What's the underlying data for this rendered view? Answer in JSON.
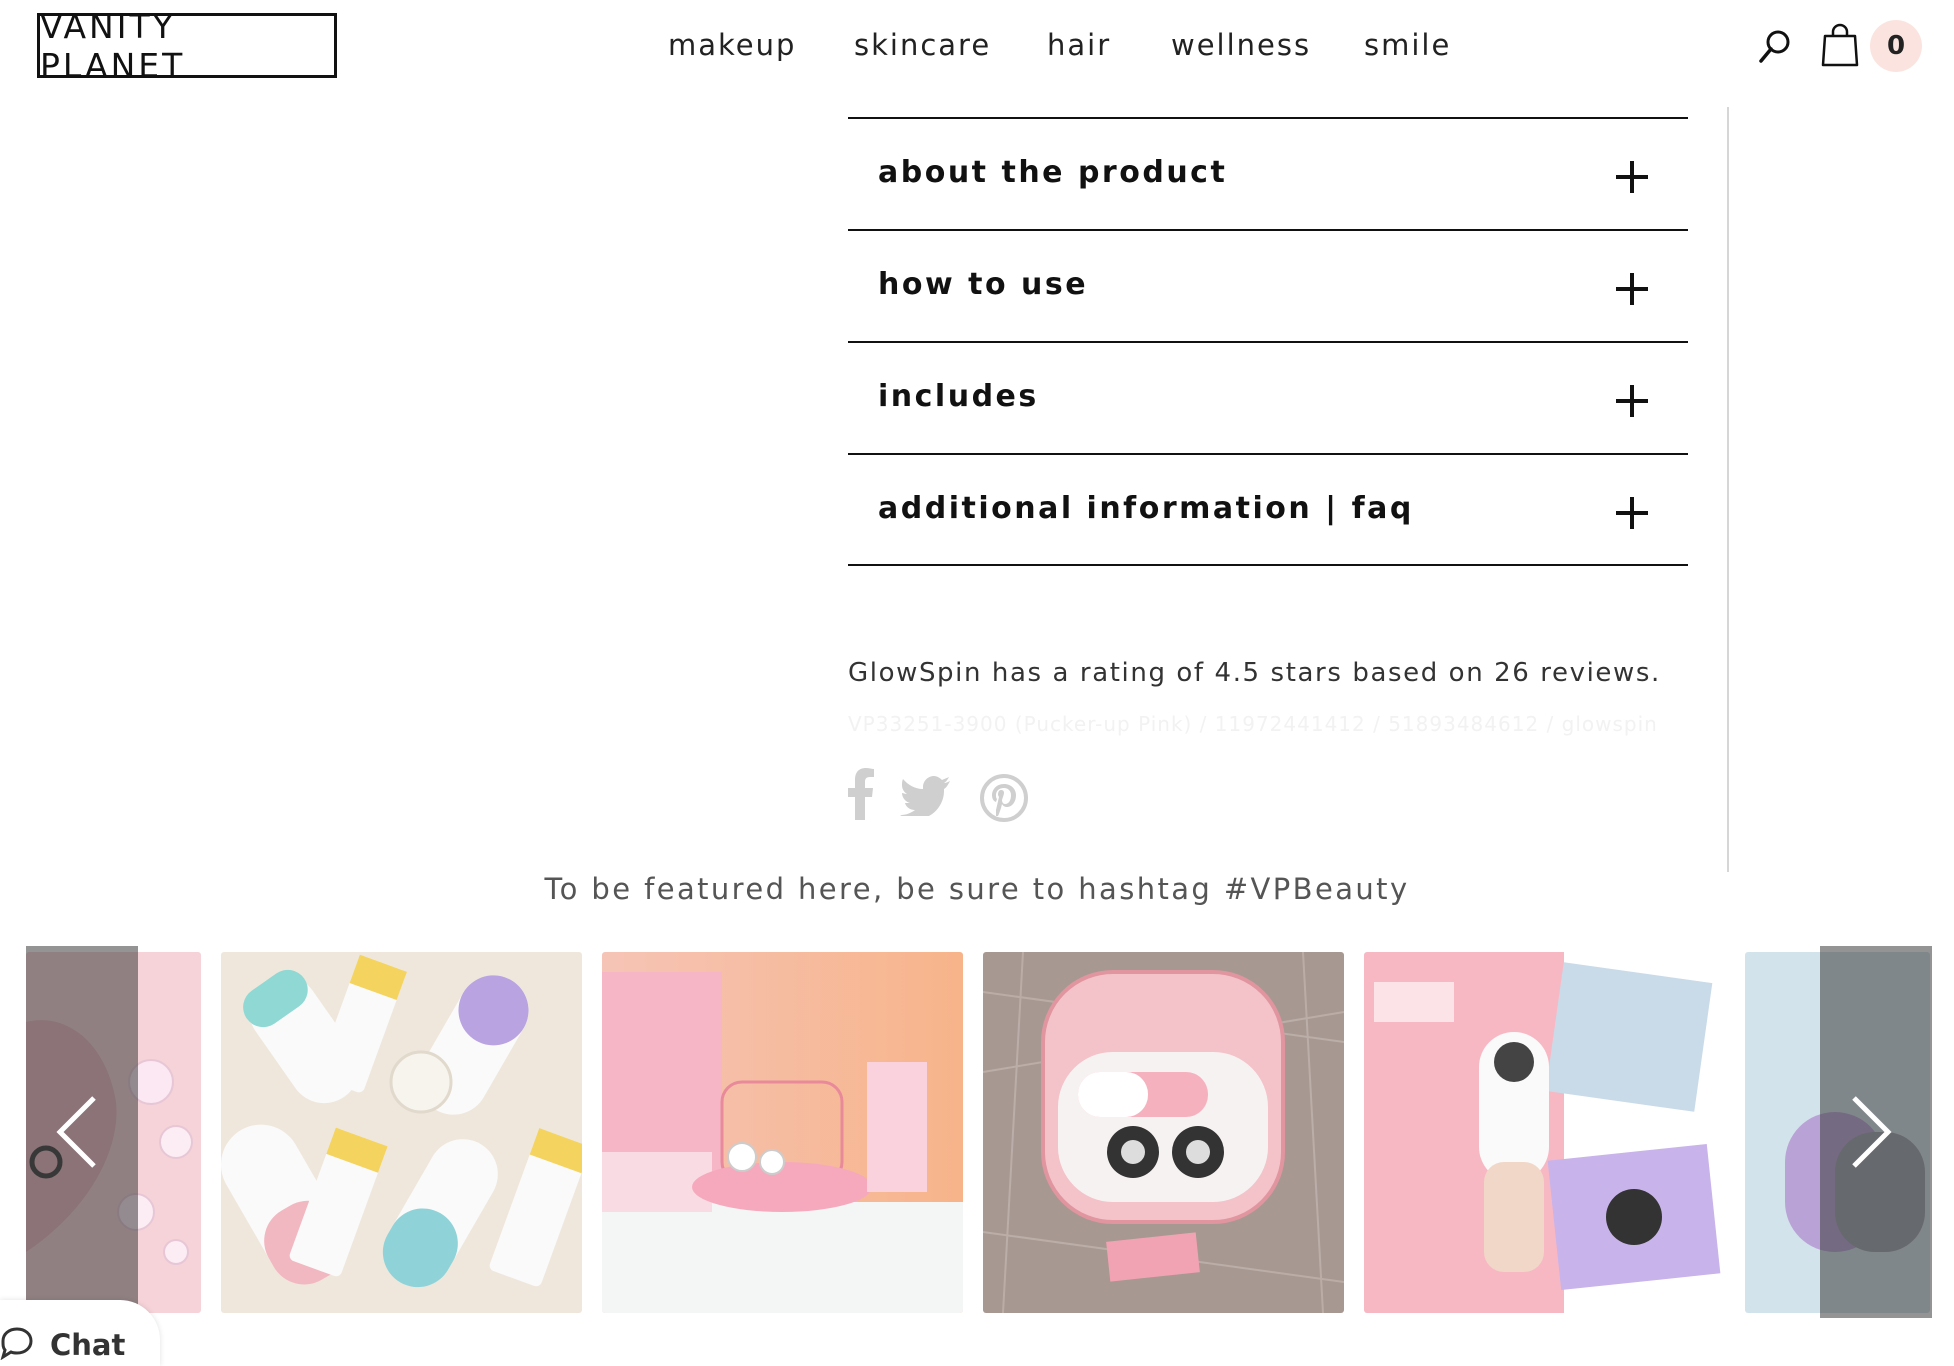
{
  "header": {
    "logo_text": "VANITY PLANET",
    "nav": [
      "makeup",
      "skincare",
      "hair",
      "wellness",
      "smile"
    ],
    "cart_count": "0",
    "icons": [
      "search-icon",
      "shopping-bag-icon"
    ]
  },
  "accordion": [
    {
      "label": "about the product"
    },
    {
      "label": "how to use"
    },
    {
      "label": "includes"
    },
    {
      "label": "additional information | faq"
    }
  ],
  "rating_text": "GlowSpin has a rating of 4.5 stars based on 26 reviews.",
  "sku_text": "VP33251-3900 (Pucker-up Pink) / 11972441412 / 51893484612 / glowspin",
  "share_icons": [
    "facebook-icon",
    "twitter-icon",
    "pinterest-icon"
  ],
  "featured_text": "To be featured here, be sure to hashtag #VPBeauty",
  "carousel": {
    "images": [
      "pink-device-with-bubbles",
      "cleansing-brushes-and-tubes",
      "glowspin-box-on-shelf",
      "pink-travel-case-on-fur",
      "ultimate-skin-spa-kit",
      "purple-brush-on-blue"
    ],
    "prev_icon": "chevron-left-icon",
    "next_icon": "chevron-right-icon"
  },
  "chat": {
    "label": "Chat"
  },
  "colors": {
    "accent": "#fbe4df",
    "text": "#111111",
    "muted": "#cccccc"
  }
}
